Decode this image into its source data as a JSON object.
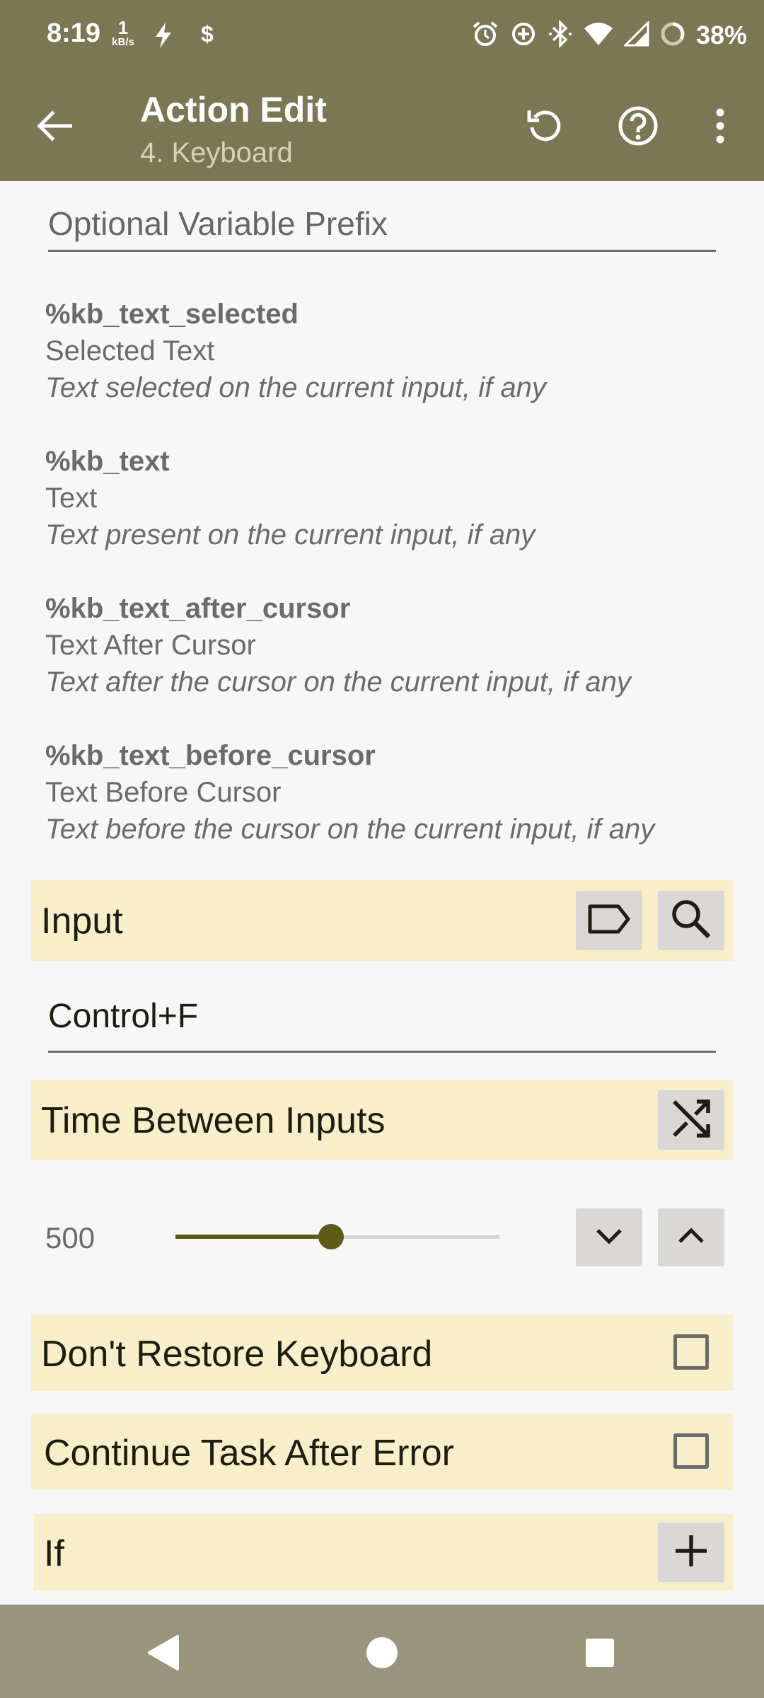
{
  "status_bar": {
    "time": "8:19",
    "net_speed_value": "1",
    "net_speed_unit": "kB/s",
    "battery": "38%"
  },
  "app_bar": {
    "title": "Action Edit",
    "subtitle": "4. Keyboard"
  },
  "prefix_field": {
    "placeholder": "Optional Variable Prefix",
    "value": ""
  },
  "variables": [
    {
      "name": "%kb_text_selected",
      "label": "Selected Text",
      "description": "Text selected on the current input, if any"
    },
    {
      "name": "%kb_text",
      "label": "Text",
      "description": "Text present on the current input, if any"
    },
    {
      "name": "%kb_text_after_cursor",
      "label": "Text After Cursor",
      "description": "Text after the cursor on the current input, if any"
    },
    {
      "name": "%kb_text_before_cursor",
      "label": "Text Before Cursor",
      "description": "Text before the cursor on the current input, if any"
    }
  ],
  "input_section": {
    "label": "Input",
    "value": "Control+F"
  },
  "time_section": {
    "label": "Time Between Inputs",
    "value": "500",
    "slider_fraction": 0.48
  },
  "dont_restore": {
    "label": "Don't Restore Keyboard",
    "checked": false
  },
  "continue_after_error": {
    "label": "Continue Task After Error",
    "checked": false
  },
  "if_section": {
    "label": "If"
  },
  "colors": {
    "app_bar": "#7b7653",
    "section_bg": "#f9eeca",
    "accent": "#5f5a18",
    "nav_bar": "#99957a"
  },
  "icons": [
    "back-arrow-icon",
    "undo-icon",
    "help-icon",
    "more-vert-icon",
    "label-tag-icon",
    "search-icon",
    "shuffle-icon",
    "chevron-down-icon",
    "chevron-up-icon",
    "plus-icon"
  ]
}
